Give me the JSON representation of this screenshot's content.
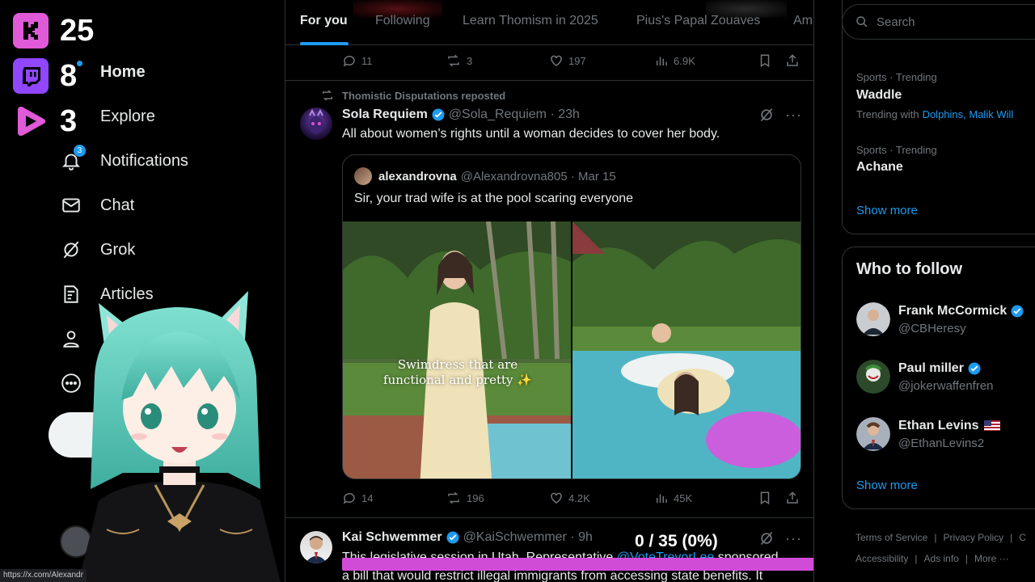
{
  "stream_overlay": {
    "kick_count": "25",
    "twitch_count": "8",
    "youtube_count": "3",
    "kick_color": "#e05ad8",
    "twitch_color": "#9146ff",
    "youtube_color": "#e05ad8"
  },
  "nav": {
    "home": "Home",
    "explore": "Explore",
    "notifications": "Notifications",
    "notifications_badge": "3",
    "chat": "Chat",
    "grok": "Grok",
    "articles": "Articles",
    "status_url": "https://x.com/Alexandr"
  },
  "tabs": [
    "For you",
    "Following",
    "Learn Thomism in 2025",
    "Pius's Papal Zouaves",
    "Am"
  ],
  "post0_actions": {
    "replies": "11",
    "reposts": "3",
    "likes": "197",
    "views": "6.9K"
  },
  "post1": {
    "repost_label": "Thomistic Disputations reposted",
    "name": "Sola Requiem",
    "handle": "@Sola_Requiem · 23h",
    "text": "All about women’s rights until a woman decides to cover her body.",
    "quote": {
      "name": "alexandrovna",
      "handle": "@Alexandrovna805 · Mar 15",
      "text": "Sir, your trad wife is at the pool scaring everyone",
      "media_caption_line1": "Swimdress that are",
      "media_caption_line2": "functional and pretty ✨"
    },
    "actions": {
      "replies": "14",
      "reposts": "196",
      "likes": "4.2K",
      "views": "45K"
    }
  },
  "post2": {
    "name": "Kai Schwemmer",
    "handle": "@KaiSchwemmer · 9h",
    "text_line1_a": "This legislative session in Utah, Representative ",
    "text_line1_mention": "@VoteTrevorLee",
    "text_line1_b": " sponsored",
    "text_line2": "a bill that would restrict illegal immigrants from accessing state benefits. It"
  },
  "progress": {
    "text": "0 / 35 (0%)",
    "value": 0,
    "bar_color": "#d14cd6"
  },
  "search": {
    "placeholder": "Search"
  },
  "trends": [
    {
      "meta": "Sports · Trending",
      "name": "Waddle",
      "with_label": "Trending with",
      "with_links": "Dolphins, Malik Will"
    },
    {
      "meta": "Sports · Trending",
      "name": "Achane"
    }
  ],
  "trends_show_more": "Show more",
  "who_to_follow": {
    "title": "Who to follow",
    "people": [
      {
        "name": "Frank McCormick",
        "handle": "@CBHeresy",
        "verified": true
      },
      {
        "name": "Paul miller",
        "handle": "@jokerwaffenfren",
        "verified": true
      },
      {
        "name": "Ethan Levins",
        "handle": "@EthanLevins2",
        "flag": "us-flag"
      }
    ],
    "show_more": "Show more"
  },
  "footer": {
    "terms": "Terms of Service",
    "privacy": "Privacy Policy",
    "c": "C",
    "accessibility": "Accessibility",
    "ads": "Ads info",
    "more": "More ···"
  },
  "colors": {
    "accent": "#1d9bf0",
    "bg": "#000000",
    "border": "#2f3336",
    "muted": "#71767b"
  }
}
